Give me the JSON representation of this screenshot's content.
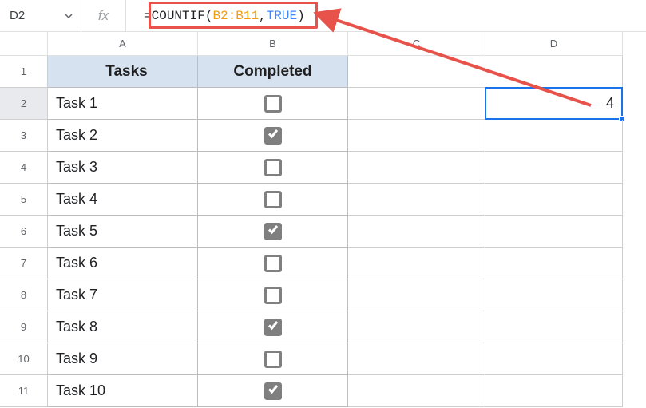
{
  "name_box": "D2",
  "formula": {
    "eq": "=",
    "func": "COUNTIF",
    "open": "(",
    "range": "B2:B11",
    "comma": ",",
    "arg": "TRUE",
    "close": ")"
  },
  "columns": [
    "A",
    "B",
    "C",
    "D"
  ],
  "row_numbers": [
    "1",
    "2",
    "3",
    "4",
    "5",
    "6",
    "7",
    "8",
    "9",
    "10",
    "11"
  ],
  "headers": {
    "A": "Tasks",
    "B": "Completed"
  },
  "tasks": [
    {
      "name": "Task 1",
      "done": false
    },
    {
      "name": "Task 2",
      "done": true
    },
    {
      "name": "Task 3",
      "done": false
    },
    {
      "name": "Task 4",
      "done": false
    },
    {
      "name": "Task 5",
      "done": true
    },
    {
      "name": "Task 6",
      "done": false
    },
    {
      "name": "Task 7",
      "done": false
    },
    {
      "name": "Task 8",
      "done": true
    },
    {
      "name": "Task 9",
      "done": false
    },
    {
      "name": "Task 10",
      "done": true
    }
  ],
  "result_cell": {
    "ref": "D2",
    "value": "4"
  },
  "colors": {
    "annotation": "#e7524b",
    "selection": "#1a73e8",
    "header_bg": "#d6e2ef"
  }
}
